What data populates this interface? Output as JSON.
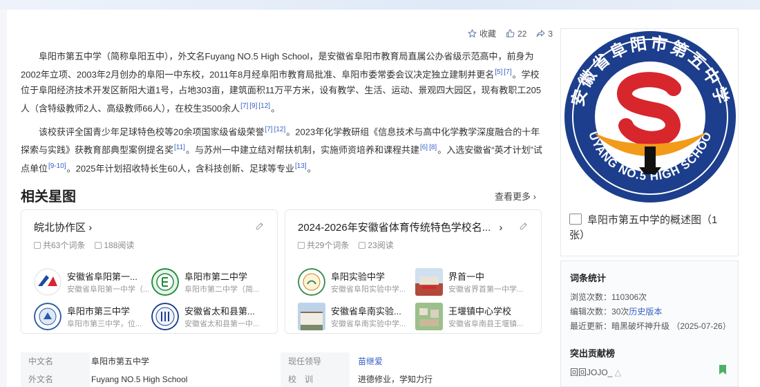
{
  "actions": {
    "favorite": "收藏",
    "likes": "22",
    "shares": "3"
  },
  "intro": {
    "p1_a": "阜阳市第五中学（简称阜阳五中），外文名Fuyang NO.5 High School，是安徽省阜阳市教育局直属公办省级示范高中，前身为2002年立项、2003年2月创办的阜阳一中东校，2011年8月经阜阳市教育局批准、阜阳市委常委会议决定独立建制并更名",
    "p1_r1": "[5]",
    "p1_r2": "[7]",
    "p1_b": "。学校位于阜阳经济技术开发区新阳大道1号，占地303亩，建筑面积11万平方米，设有教学、生活、运动、景观四大园区，现有教职工205人（含特级教师2人、高级教师66人），在校生3500余人",
    "p1_r3": "[7]",
    "p1_r4": "[9]",
    "p1_r5": "[12]",
    "p1_c": "。",
    "p2_a": "该校获评全国青少年足球特色校等20余项国家级省级荣誉",
    "p2_r1": "[7]",
    "p2_r2": "[12]",
    "p2_b": "。2023年化学教研组《信息技术与高中化学教学深度融合的十年探索与实践》获教育部典型案例提名奖",
    "p2_r3": "[11]",
    "p2_c": "。与苏州一中建立结对帮扶机制，实施师资培养和课程共建",
    "p2_r4": "[6]",
    "p2_r5": "[8]",
    "p2_d": "。入选安徽省“英才计划”试点单位",
    "p2_r6": "[9-10]",
    "p2_e": "。2025年计划招收特长生60人，含科技创新、足球等专业",
    "p2_r7": "[13]",
    "p2_f": "。"
  },
  "related": {
    "title": "相关星图",
    "more": "查看更多",
    "cards": [
      {
        "title": "皖北协作区",
        "count": "共63个词条",
        "reads": "188阅读",
        "entries": [
          {
            "name": "安徽省阜阳第一...",
            "desc": "安徽省阜阳第一中学（..."
          },
          {
            "name": "阜阳市第二中学",
            "desc": "阜阳市第二中学（简..."
          },
          {
            "name": "阜阳市第三中学",
            "desc": "阜阳市第三中学，位..."
          },
          {
            "name": "安徽省太和县第...",
            "desc": "安徽省太和县第一中..."
          }
        ]
      },
      {
        "title": "2024-2026年安徽省体育传统特色学校名...",
        "count": "共29个词条",
        "reads": "23阅读",
        "entries": [
          {
            "name": "阜阳实验中学",
            "desc": "安徽省阜阳实验中学..."
          },
          {
            "name": "界首一中",
            "desc": "安徽省界首第一中学..."
          },
          {
            "name": "安徽省阜南实验...",
            "desc": "安徽省阜南实验中学..."
          },
          {
            "name": "王堰镇中心学校",
            "desc": "安徽省阜南县王堰镇..."
          }
        ]
      }
    ]
  },
  "infobox": {
    "rows": [
      {
        "l1": "中文名",
        "v1": "阜阳市第五中学",
        "l2": "现任领导",
        "v2": "苗继爱"
      },
      {
        "l1": "外文名",
        "v1": "Fuyang NO.5 High School",
        "l2": "校　训",
        "v2": "进德修业，学知力行"
      }
    ]
  },
  "logo": {
    "arc_text": "安徽省阜阳市第五中学",
    "bottom_text": "FUYANG NO.5 HIGH SCHOOL",
    "caption": "阜阳市第五中学的概述图（1张）",
    "colors": {
      "blue": "#1c3e8c",
      "red": "#d8262d",
      "orange": "#f29a1a"
    }
  },
  "stats": {
    "title": "词条统计",
    "views_label": "浏览次数：",
    "views": "110306次",
    "edits_label": "编辑次数：",
    "edits": "30次",
    "history": "历史版本",
    "updated_label": "最近更新：",
    "updated": "暗黑破坏神升级 （2025-07-26）",
    "contrib_title": "突出贡献榜",
    "user": "回回JOJO_"
  }
}
